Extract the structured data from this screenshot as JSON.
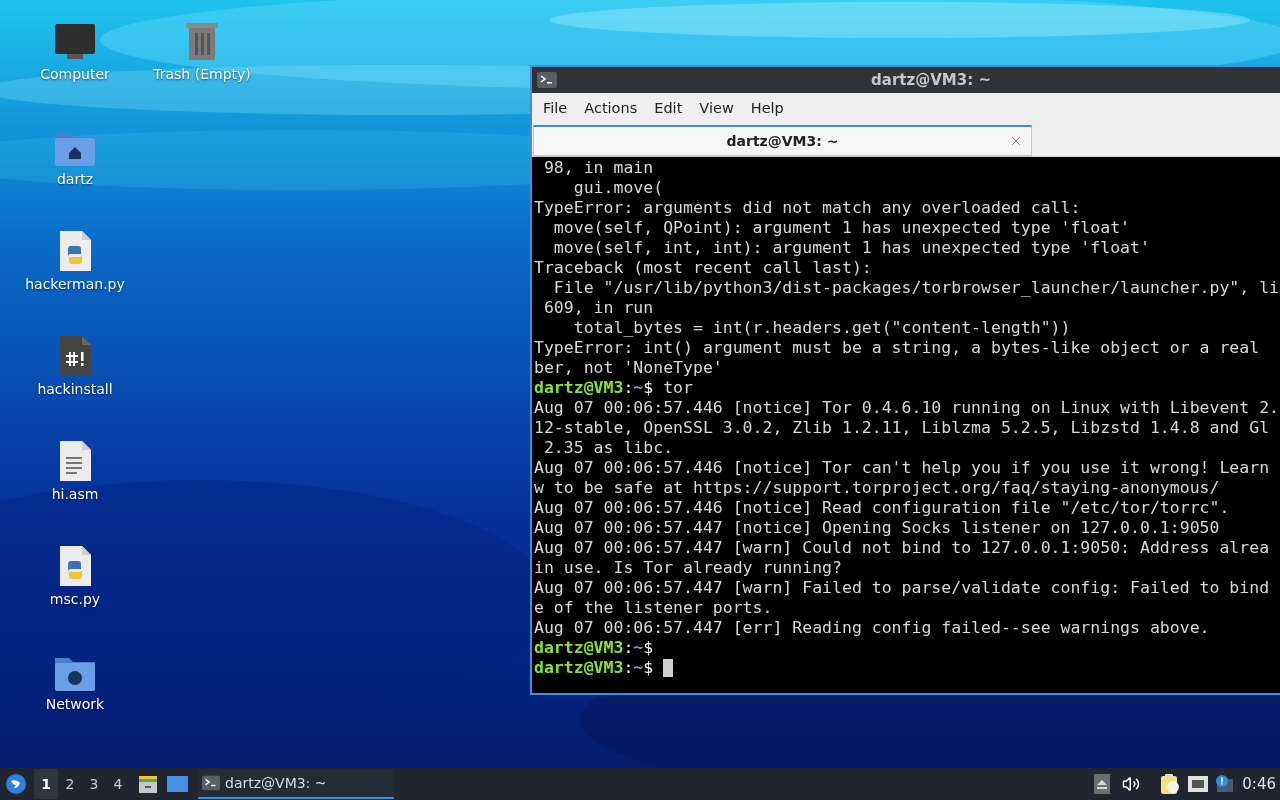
{
  "desktop_icons": [
    {
      "label": "Computer",
      "kind": "monitor"
    },
    {
      "label": "Trash (Empty)",
      "kind": "trash"
    },
    {
      "label": "dartz",
      "kind": "home-folder"
    },
    {
      "label": "hackerman.py",
      "kind": "python"
    },
    {
      "label": "hackinstall",
      "kind": "script"
    },
    {
      "label": "hi.asm",
      "kind": "text"
    },
    {
      "label": "msc.py",
      "kind": "python"
    },
    {
      "label": "Network",
      "kind": "network-folder"
    }
  ],
  "terminal": {
    "title": "dartz@VM3: ~",
    "menu": [
      "File",
      "Actions",
      "Edit",
      "View",
      "Help"
    ],
    "tabs": [
      {
        "label": "dartz@VM3: ~",
        "selected": true
      }
    ],
    "lines": [
      {
        "kind": "output",
        "text": " 98, in main"
      },
      {
        "kind": "output",
        "text": "    gui.move("
      },
      {
        "kind": "output",
        "text": "TypeError: arguments did not match any overloaded call:"
      },
      {
        "kind": "output",
        "text": "  move(self, QPoint): argument 1 has unexpected type 'float'"
      },
      {
        "kind": "output",
        "text": "  move(self, int, int): argument 1 has unexpected type 'float'"
      },
      {
        "kind": "output",
        "text": "Traceback (most recent call last):"
      },
      {
        "kind": "output",
        "text": "  File \"/usr/lib/python3/dist-packages/torbrowser_launcher/launcher.py\", li"
      },
      {
        "kind": "output",
        "text": " 609, in run"
      },
      {
        "kind": "output",
        "text": "    total_bytes = int(r.headers.get(\"content-length\"))"
      },
      {
        "kind": "output",
        "text": "TypeError: int() argument must be a string, a bytes-like object or a real"
      },
      {
        "kind": "output",
        "text": "ber, not 'NoneType'"
      },
      {
        "kind": "prompt",
        "user": "dartz@VM3",
        "sep": ":",
        "path": "~",
        "symbol": "$",
        "command": " tor",
        "cursor": false
      },
      {
        "kind": "output",
        "text": "Aug 07 00:06:57.446 [notice] Tor 0.4.6.10 running on Linux with Libevent 2."
      },
      {
        "kind": "output",
        "text": "12-stable, OpenSSL 3.0.2, Zlib 1.2.11, Liblzma 5.2.5, Libzstd 1.4.8 and Gl"
      },
      {
        "kind": "output",
        "text": " 2.35 as libc."
      },
      {
        "kind": "output",
        "text": "Aug 07 00:06:57.446 [notice] Tor can't help you if you use it wrong! Learn"
      },
      {
        "kind": "output",
        "text": "w to be safe at https://support.torproject.org/faq/staying-anonymous/"
      },
      {
        "kind": "output",
        "text": "Aug 07 00:06:57.446 [notice] Read configuration file \"/etc/tor/torrc\"."
      },
      {
        "kind": "output",
        "text": "Aug 07 00:06:57.447 [notice] Opening Socks listener on 127.0.0.1:9050"
      },
      {
        "kind": "output",
        "text": "Aug 07 00:06:57.447 [warn] Could not bind to 127.0.0.1:9050: Address alrea"
      },
      {
        "kind": "output",
        "text": "in use. Is Tor already running?"
      },
      {
        "kind": "output",
        "text": "Aug 07 00:06:57.447 [warn] Failed to parse/validate config: Failed to bind"
      },
      {
        "kind": "output",
        "text": "e of the listener ports."
      },
      {
        "kind": "output",
        "text": "Aug 07 00:06:57.447 [err] Reading config failed--see warnings above."
      },
      {
        "kind": "prompt",
        "user": "dartz@VM3",
        "sep": ":",
        "path": "~",
        "symbol": "$",
        "cursor": false
      },
      {
        "kind": "prompt",
        "user": "dartz@VM3",
        "sep": ":",
        "path": "~",
        "symbol": "$",
        "cursor": true
      }
    ]
  },
  "taskbar": {
    "workspaces": [
      {
        "label": "1",
        "selected": true
      },
      {
        "label": "2",
        "selected": false
      },
      {
        "label": "3",
        "selected": false
      },
      {
        "label": "4",
        "selected": false
      }
    ],
    "tasks": [
      {
        "label": "dartz@VM3: ~",
        "selected": true
      }
    ],
    "clock": "0:46"
  }
}
